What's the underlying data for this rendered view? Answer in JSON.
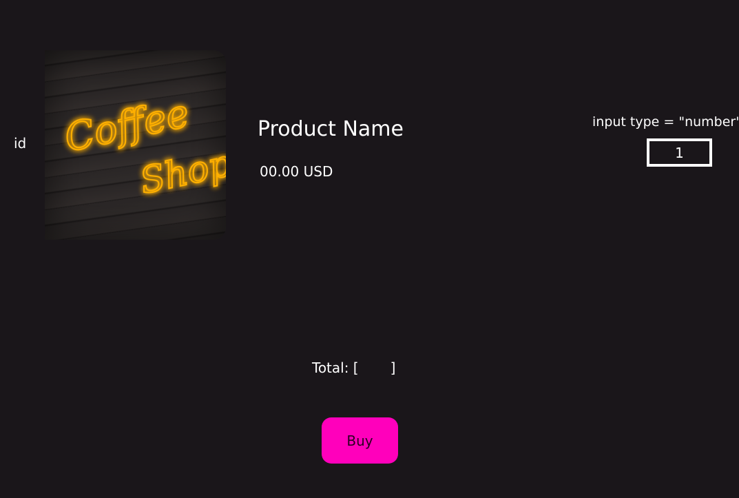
{
  "product": {
    "id_label": "id",
    "image_alt": "Coffee Shop neon sign",
    "image_sign_line1": "Coffee",
    "image_sign_line2": "Shop",
    "name": "Product Name",
    "price": "00.00 USD"
  },
  "quantity": {
    "caption": "input type = \"number\"",
    "value": "1"
  },
  "total": {
    "label": "Total: [",
    "close": "]"
  },
  "buy_button": {
    "label": "Buy"
  },
  "colors": {
    "background": "#1a161a",
    "accent": "#ff00bb",
    "neon": "#ffb000"
  }
}
